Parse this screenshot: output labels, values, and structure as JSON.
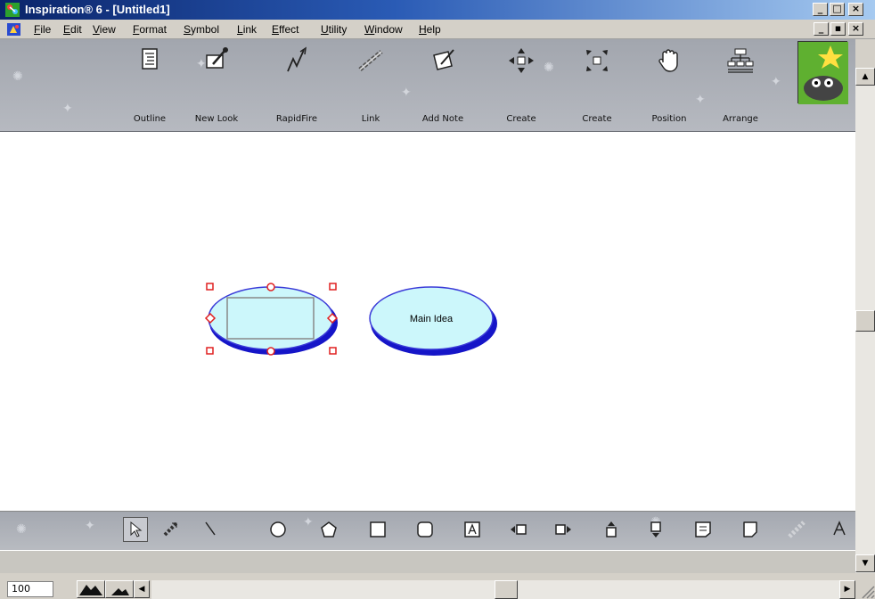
{
  "window": {
    "title": "Inspiration® 6 - [Untitled1]",
    "caption_buttons": [
      "_",
      "□",
      "×"
    ]
  },
  "menu": {
    "items": [
      "File",
      "Edit",
      "View",
      "Format",
      "Symbol",
      "Link",
      "Effect",
      "Utility",
      "Window",
      "Help"
    ],
    "mdi_buttons": [
      "_",
      "▪",
      "×"
    ]
  },
  "toolbar": {
    "buttons": [
      {
        "label": "Outline",
        "icon": "outline-icon"
      },
      {
        "label": "New Look",
        "icon": "new-look-icon"
      },
      {
        "label": "RapidFire",
        "icon": "rapidfire-icon"
      },
      {
        "label": "Link",
        "icon": "link-icon"
      },
      {
        "label": "Add Note",
        "icon": "add-note-icon"
      },
      {
        "label": "Create",
        "icon": "create-arrows-icon"
      },
      {
        "label": "Create",
        "icon": "create-corners-icon"
      },
      {
        "label": "Position",
        "icon": "hand-icon"
      },
      {
        "label": "Arrange",
        "icon": "arrange-icon"
      }
    ]
  },
  "canvas": {
    "symbols": [
      {
        "label": "",
        "selected": true
      },
      {
        "label": "Main Idea",
        "selected": false
      }
    ]
  },
  "drawing_tools": [
    "pointer-tool",
    "link-tool",
    "line-tool",
    "circle-tool",
    "polygon-tool",
    "square-tool",
    "rounded-square-tool",
    "text-tool",
    "add-left-tool",
    "add-right-tool",
    "add-top-tool",
    "add-bottom-tool",
    "note-tool",
    "rounded-note-tool",
    "hyperlink-tool",
    "font-tool"
  ],
  "bottom": {
    "zoom_value": "100"
  },
  "colors": {
    "symbol_fill": "#ccf7fb",
    "symbol_shadow": "#1515c8",
    "selection_handle": "#e02020"
  }
}
